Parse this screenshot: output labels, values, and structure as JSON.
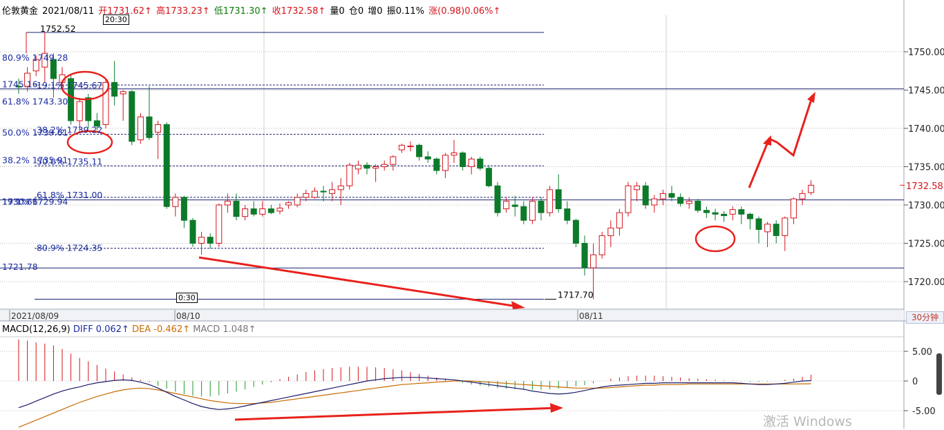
{
  "header": {
    "symbol": "伦敦黄金",
    "date": "2021/08/11",
    "open": "开1731.62↑",
    "high": "高1733.23↑",
    "low": "低1731.30↑",
    "close": "收1732.58↑",
    "volume": "量0",
    "open_interest": "仓0",
    "increase": "增0",
    "amplitude": "振0.11%",
    "change": "涨(0.98)0.06%↑"
  },
  "cursor_time_top": "20:30",
  "cursor_time_bottom": "0:30",
  "period_button": "30分钟",
  "last_price": "1732.58",
  "watermark": "激活 Windows",
  "macd_header": {
    "name": "MACD(12,26,9)",
    "diff": "DIFF 0.062↑",
    "dea": "DEA -0.462↑",
    "macd": "MACD 1.048↑"
  },
  "colors": {
    "up": "#d4131a",
    "down": "#0d7a2a",
    "fib_text": "#1a2ba0",
    "annotation": "#e8211c",
    "diff_line": "#1a1a6a",
    "dea_line": "#c76b00"
  },
  "chart_data": {
    "type": "candlestick",
    "instrument": "伦敦黄金",
    "period": "30分钟",
    "ylim": [
      1718,
      1754
    ],
    "y_ticks": [
      "1750.00",
      "1745.00",
      "1740.00",
      "1735.00",
      "1730.00",
      "1725.00",
      "1720.00"
    ],
    "x_labels": [
      "2021/08/09",
      "08/10",
      "08/11"
    ],
    "fib_labels": [
      {
        "text": "1752.52",
        "value": 1752.52
      },
      {
        "text": "80.9% 1749.28",
        "value": 1749.28
      },
      {
        "text": "1745.16",
        "value": 1745.16
      },
      {
        "text": "19.1% 1745.67",
        "value": 1745.67
      },
      {
        "text": "61.8% 1743.30",
        "value": 1743.3
      },
      {
        "text": "50.0% 1739.61",
        "value": 1739.61
      },
      {
        "text": "38.2% 1739.22",
        "value": 1739.22
      },
      {
        "text": "38.2% 1735.91",
        "value": 1735.91
      },
      {
        "text": "50.0% 1735.11",
        "value": 1735.11
      },
      {
        "text": "1730.66",
        "value": 1730.66
      },
      {
        "text": "61.8% 1731.00",
        "value": 1731.0
      },
      {
        "text": "19.1% 1729.94",
        "value": 1729.94
      },
      {
        "text": "80.9% 1724.35",
        "value": 1724.35
      },
      {
        "text": "1721.78",
        "value": 1721.78
      },
      {
        "text": "1717.70",
        "value": 1717.7
      }
    ],
    "candles": [
      {
        "o": 1745.5,
        "h": 1746.5,
        "l": 1744.5,
        "c": 1745.4
      },
      {
        "o": 1745.5,
        "h": 1748.0,
        "l": 1744.8,
        "c": 1747.2
      },
      {
        "o": 1747.5,
        "h": 1749.5,
        "l": 1746.8,
        "c": 1749.0
      },
      {
        "o": 1748.0,
        "h": 1752.52,
        "l": 1746.0,
        "c": 1749.8
      },
      {
        "o": 1749.0,
        "h": 1749.8,
        "l": 1744.0,
        "c": 1746.5
      },
      {
        "o": 1746.0,
        "h": 1748.0,
        "l": 1745.0,
        "c": 1747.0
      },
      {
        "o": 1746.5,
        "h": 1747.0,
        "l": 1740.5,
        "c": 1741.0
      },
      {
        "o": 1741.0,
        "h": 1744.0,
        "l": 1739.5,
        "c": 1743.5
      },
      {
        "o": 1744.0,
        "h": 1744.5,
        "l": 1740.0,
        "c": 1741.0
      },
      {
        "o": 1741.0,
        "h": 1742.0,
        "l": 1739.8,
        "c": 1740.3
      },
      {
        "o": 1740.5,
        "h": 1746.5,
        "l": 1740.0,
        "c": 1746.0
      },
      {
        "o": 1746.0,
        "h": 1748.8,
        "l": 1743.0,
        "c": 1744.2
      },
      {
        "o": 1744.5,
        "h": 1745.0,
        "l": 1741.0,
        "c": 1744.8
      },
      {
        "o": 1744.8,
        "h": 1745.0,
        "l": 1737.8,
        "c": 1738.3
      },
      {
        "o": 1738.5,
        "h": 1742.0,
        "l": 1738.0,
        "c": 1741.5
      },
      {
        "o": 1741.5,
        "h": 1745.5,
        "l": 1738.5,
        "c": 1738.8
      },
      {
        "o": 1739.5,
        "h": 1741.0,
        "l": 1736.0,
        "c": 1740.5
      },
      {
        "o": 1740.5,
        "h": 1740.8,
        "l": 1729.5,
        "c": 1729.8
      },
      {
        "o": 1729.8,
        "h": 1731.5,
        "l": 1728.5,
        "c": 1731.0
      },
      {
        "o": 1731.0,
        "h": 1731.2,
        "l": 1727.0,
        "c": 1728.0
      },
      {
        "o": 1728.0,
        "h": 1728.3,
        "l": 1724.5,
        "c": 1725.0
      },
      {
        "o": 1725.0,
        "h": 1726.5,
        "l": 1723.5,
        "c": 1725.8
      },
      {
        "o": 1725.8,
        "h": 1726.3,
        "l": 1724.3,
        "c": 1725.0
      },
      {
        "o": 1725.0,
        "h": 1730.2,
        "l": 1724.5,
        "c": 1730.0
      },
      {
        "o": 1730.0,
        "h": 1731.5,
        "l": 1729.0,
        "c": 1730.5
      },
      {
        "o": 1730.5,
        "h": 1731.5,
        "l": 1728.0,
        "c": 1728.5
      },
      {
        "o": 1728.5,
        "h": 1730.0,
        "l": 1728.0,
        "c": 1729.5
      },
      {
        "o": 1729.5,
        "h": 1730.5,
        "l": 1728.5,
        "c": 1728.8
      },
      {
        "o": 1728.8,
        "h": 1730.5,
        "l": 1728.5,
        "c": 1729.5
      },
      {
        "o": 1729.5,
        "h": 1730.0,
        "l": 1728.8,
        "c": 1729.0
      },
      {
        "o": 1729.2,
        "h": 1730.2,
        "l": 1728.8,
        "c": 1729.6
      },
      {
        "o": 1730.0,
        "h": 1730.5,
        "l": 1729.5,
        "c": 1730.3
      },
      {
        "o": 1730.0,
        "h": 1731.5,
        "l": 1729.7,
        "c": 1731.0
      },
      {
        "o": 1731.0,
        "h": 1732.0,
        "l": 1730.5,
        "c": 1731.5
      },
      {
        "o": 1731.0,
        "h": 1732.3,
        "l": 1730.8,
        "c": 1731.8
      },
      {
        "o": 1731.8,
        "h": 1732.5,
        "l": 1730.5,
        "c": 1731.7
      },
      {
        "o": 1731.5,
        "h": 1733.0,
        "l": 1730.5,
        "c": 1732.0
      },
      {
        "o": 1732.0,
        "h": 1733.5,
        "l": 1730.0,
        "c": 1732.5
      },
      {
        "o": 1732.5,
        "h": 1735.5,
        "l": 1732.0,
        "c": 1735.2
      },
      {
        "o": 1734.7,
        "h": 1735.8,
        "l": 1734.0,
        "c": 1735.2
      },
      {
        "o": 1735.2,
        "h": 1735.6,
        "l": 1734.0,
        "c": 1734.8
      },
      {
        "o": 1734.8,
        "h": 1735.3,
        "l": 1733.0,
        "c": 1735.0
      },
      {
        "o": 1735.0,
        "h": 1735.8,
        "l": 1734.5,
        "c": 1735.3
      },
      {
        "o": 1735.3,
        "h": 1736.5,
        "l": 1734.5,
        "c": 1736.3
      },
      {
        "o": 1737.2,
        "h": 1738.0,
        "l": 1736.8,
        "c": 1737.8
      },
      {
        "o": 1737.6,
        "h": 1738.3,
        "l": 1737.0,
        "c": 1737.7
      },
      {
        "o": 1737.8,
        "h": 1738.0,
        "l": 1735.8,
        "c": 1736.3
      },
      {
        "o": 1736.3,
        "h": 1737.0,
        "l": 1735.5,
        "c": 1736.0
      },
      {
        "o": 1736.0,
        "h": 1736.2,
        "l": 1734.0,
        "c": 1734.5
      },
      {
        "o": 1734.5,
        "h": 1736.8,
        "l": 1733.5,
        "c": 1736.5
      },
      {
        "o": 1736.5,
        "h": 1738.5,
        "l": 1735.5,
        "c": 1736.8
      },
      {
        "o": 1736.8,
        "h": 1737.0,
        "l": 1734.5,
        "c": 1735.0
      },
      {
        "o": 1735.0,
        "h": 1736.3,
        "l": 1734.0,
        "c": 1736.0
      },
      {
        "o": 1736.0,
        "h": 1736.3,
        "l": 1734.5,
        "c": 1734.8
      },
      {
        "o": 1734.8,
        "h": 1735.2,
        "l": 1732.3,
        "c": 1732.5
      },
      {
        "o": 1732.5,
        "h": 1733.0,
        "l": 1728.5,
        "c": 1729.0
      },
      {
        "o": 1729.5,
        "h": 1731.0,
        "l": 1729.0,
        "c": 1730.5
      },
      {
        "o": 1730.0,
        "h": 1731.2,
        "l": 1728.5,
        "c": 1729.8
      },
      {
        "o": 1729.8,
        "h": 1730.5,
        "l": 1727.5,
        "c": 1728.0
      },
      {
        "o": 1728.0,
        "h": 1731.0,
        "l": 1727.5,
        "c": 1730.5
      },
      {
        "o": 1730.5,
        "h": 1731.0,
        "l": 1728.0,
        "c": 1729.0
      },
      {
        "o": 1729.0,
        "h": 1732.5,
        "l": 1728.5,
        "c": 1732.0
      },
      {
        "o": 1732.0,
        "h": 1734.0,
        "l": 1729.0,
        "c": 1729.5
      },
      {
        "o": 1729.5,
        "h": 1730.5,
        "l": 1727.5,
        "c": 1728.0
      },
      {
        "o": 1728.0,
        "h": 1728.2,
        "l": 1724.5,
        "c": 1725.0
      },
      {
        "o": 1725.0,
        "h": 1726.0,
        "l": 1720.8,
        "c": 1721.8
      },
      {
        "o": 1721.8,
        "h": 1725.0,
        "l": 1717.7,
        "c": 1723.5
      },
      {
        "o": 1723.5,
        "h": 1726.5,
        "l": 1723.0,
        "c": 1726.0
      },
      {
        "o": 1726.0,
        "h": 1728.0,
        "l": 1724.5,
        "c": 1727.0
      },
      {
        "o": 1727.0,
        "h": 1729.5,
        "l": 1726.0,
        "c": 1729.0
      },
      {
        "o": 1729.0,
        "h": 1733.0,
        "l": 1728.5,
        "c": 1732.5
      },
      {
        "o": 1732.0,
        "h": 1733.0,
        "l": 1730.5,
        "c": 1732.5
      },
      {
        "o": 1732.5,
        "h": 1733.0,
        "l": 1729.5,
        "c": 1730.0
      },
      {
        "o": 1730.0,
        "h": 1731.3,
        "l": 1729.0,
        "c": 1730.8
      },
      {
        "o": 1730.8,
        "h": 1732.0,
        "l": 1730.0,
        "c": 1731.5
      },
      {
        "o": 1731.5,
        "h": 1732.5,
        "l": 1730.5,
        "c": 1731.0
      },
      {
        "o": 1731.0,
        "h": 1731.5,
        "l": 1729.8,
        "c": 1730.2
      },
      {
        "o": 1730.2,
        "h": 1731.0,
        "l": 1729.5,
        "c": 1730.5
      },
      {
        "o": 1730.5,
        "h": 1730.8,
        "l": 1729.0,
        "c": 1729.3
      },
      {
        "o": 1729.3,
        "h": 1729.8,
        "l": 1728.3,
        "c": 1729.0
      },
      {
        "o": 1729.0,
        "h": 1729.5,
        "l": 1728.0,
        "c": 1728.8
      },
      {
        "o": 1728.8,
        "h": 1729.2,
        "l": 1727.8,
        "c": 1728.6
      },
      {
        "o": 1728.8,
        "h": 1729.8,
        "l": 1728.0,
        "c": 1729.4
      },
      {
        "o": 1729.4,
        "h": 1729.8,
        "l": 1727.5,
        "c": 1728.8
      },
      {
        "o": 1728.8,
        "h": 1729.0,
        "l": 1726.8,
        "c": 1728.2
      },
      {
        "o": 1728.2,
        "h": 1728.5,
        "l": 1725.0,
        "c": 1726.8
      },
      {
        "o": 1726.5,
        "h": 1727.8,
        "l": 1724.5,
        "c": 1727.5
      },
      {
        "o": 1727.5,
        "h": 1728.0,
        "l": 1725.0,
        "c": 1726.0
      },
      {
        "o": 1726.0,
        "h": 1728.5,
        "l": 1724.0,
        "c": 1728.3
      },
      {
        "o": 1728.3,
        "h": 1731.0,
        "l": 1727.5,
        "c": 1730.8
      },
      {
        "o": 1730.8,
        "h": 1732.0,
        "l": 1730.0,
        "c": 1731.5
      },
      {
        "o": 1731.62,
        "h": 1733.23,
        "l": 1731.3,
        "c": 1732.58
      }
    ],
    "macd": {
      "ylim": [
        -6.5,
        9
      ],
      "y_ticks": [
        "5.00",
        "0",
        "-5.00"
      ],
      "hist": [
        7.0,
        6.8,
        6.5,
        6.3,
        6.0,
        5.4,
        4.6,
        3.9,
        3.3,
        2.7,
        2.1,
        1.6,
        1.1,
        0.6,
        0.2,
        -0.2,
        -0.8,
        -1.3,
        -1.8,
        -2.2,
        -2.5,
        -2.6,
        -2.6,
        -2.4,
        -2.1,
        -1.8,
        -1.4,
        -1.0,
        -0.6,
        -0.2,
        0.3,
        0.7,
        1.1,
        1.5,
        1.8,
        2.0,
        2.2,
        2.3,
        2.4,
        2.4,
        2.4,
        2.3,
        2.2,
        2.0,
        1.8,
        1.5,
        1.2,
        0.9,
        0.6,
        0.3,
        0.0,
        -0.3,
        -0.6,
        -0.8,
        -1.0,
        -1.2,
        -1.3,
        -1.4,
        -1.5,
        -1.5,
        -1.5,
        -1.4,
        -1.3,
        -1.1,
        -0.9,
        -0.7,
        -0.4,
        0.0,
        0.4,
        0.6,
        0.8,
        0.9,
        0.9,
        0.9,
        0.8,
        0.7,
        0.6,
        0.5,
        0.4,
        0.3,
        0.2,
        0.1,
        0.05,
        -0.05,
        -0.1,
        -0.15,
        -0.1,
        0.0,
        0.2,
        0.4,
        0.7,
        1.048
      ],
      "diff": [
        -4.5,
        -4.0,
        -3.4,
        -2.8,
        -2.2,
        -1.7,
        -1.3,
        -1.0,
        -0.6,
        -0.3,
        -0.1,
        0.1,
        0.2,
        0.1,
        -0.2,
        -0.6,
        -1.2,
        -1.9,
        -2.6,
        -3.2,
        -3.8,
        -4.3,
        -4.6,
        -4.8,
        -4.7,
        -4.5,
        -4.2,
        -3.9,
        -3.6,
        -3.3,
        -3.0,
        -2.7,
        -2.4,
        -2.1,
        -1.8,
        -1.5,
        -1.2,
        -0.9,
        -0.6,
        -0.3,
        0.0,
        0.2,
        0.4,
        0.5,
        0.6,
        0.6,
        0.6,
        0.5,
        0.4,
        0.3,
        0.2,
        0.0,
        -0.2,
        -0.4,
        -0.6,
        -0.8,
        -1.0,
        -1.2,
        -1.4,
        -1.7,
        -1.9,
        -2.1,
        -2.2,
        -2.1,
        -1.9,
        -1.6,
        -1.3,
        -1.0,
        -0.8,
        -0.7,
        -0.6,
        -0.5,
        -0.4,
        -0.4,
        -0.3,
        -0.3,
        -0.3,
        -0.3,
        -0.3,
        -0.3,
        -0.3,
        -0.3,
        -0.3,
        -0.4,
        -0.5,
        -0.6,
        -0.6,
        -0.5,
        -0.4,
        -0.2,
        0.0,
        0.062
      ],
      "dea": [
        -7.8,
        -7.2,
        -6.6,
        -6.0,
        -5.4,
        -4.8,
        -4.2,
        -3.6,
        -3.1,
        -2.6,
        -2.2,
        -1.8,
        -1.5,
        -1.3,
        -1.2,
        -1.3,
        -1.5,
        -1.8,
        -2.1,
        -2.4,
        -2.7,
        -3.0,
        -3.3,
        -3.5,
        -3.7,
        -3.8,
        -3.8,
        -3.8,
        -3.7,
        -3.6,
        -3.4,
        -3.2,
        -3.0,
        -2.8,
        -2.6,
        -2.4,
        -2.2,
        -2.0,
        -1.8,
        -1.6,
        -1.4,
        -1.2,
        -1.0,
        -0.8,
        -0.6,
        -0.5,
        -0.4,
        -0.3,
        -0.2,
        -0.1,
        0.0,
        0.0,
        0.0,
        -0.1,
        -0.2,
        -0.3,
        -0.4,
        -0.5,
        -0.6,
        -0.7,
        -0.8,
        -0.9,
        -1.0,
        -1.1,
        -1.2,
        -1.2,
        -1.2,
        -1.2,
        -1.1,
        -1.0,
        -0.9,
        -0.8,
        -0.7,
        -0.7,
        -0.6,
        -0.6,
        -0.6,
        -0.5,
        -0.5,
        -0.5,
        -0.5,
        -0.5,
        -0.5,
        -0.5,
        -0.5,
        -0.5,
        -0.5,
        -0.5,
        -0.5,
        -0.5,
        -0.48,
        -0.462
      ]
    }
  }
}
